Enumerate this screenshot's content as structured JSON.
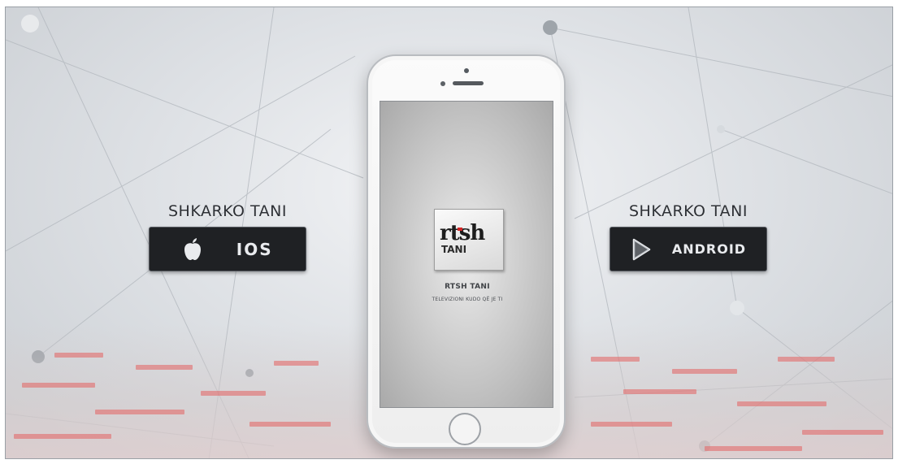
{
  "stores": {
    "ios": {
      "heading": "SHKARKO TANI",
      "label": "IOS",
      "icon": "apple-logo-icon"
    },
    "android": {
      "heading": "SHKARKO TANI",
      "label": "ANDROID",
      "icon": "play-store-icon"
    }
  },
  "phone_screen": {
    "logo_brand": "rtsh",
    "logo_sub": "TANI",
    "app_title": "RTSH TANI",
    "app_tagline": "TELEVIZIONI KUDO QË JE TI"
  },
  "colors": {
    "button_bg": "#1f2124",
    "logo_accent": "#d32626",
    "floor_accent": "#e36b6b"
  }
}
